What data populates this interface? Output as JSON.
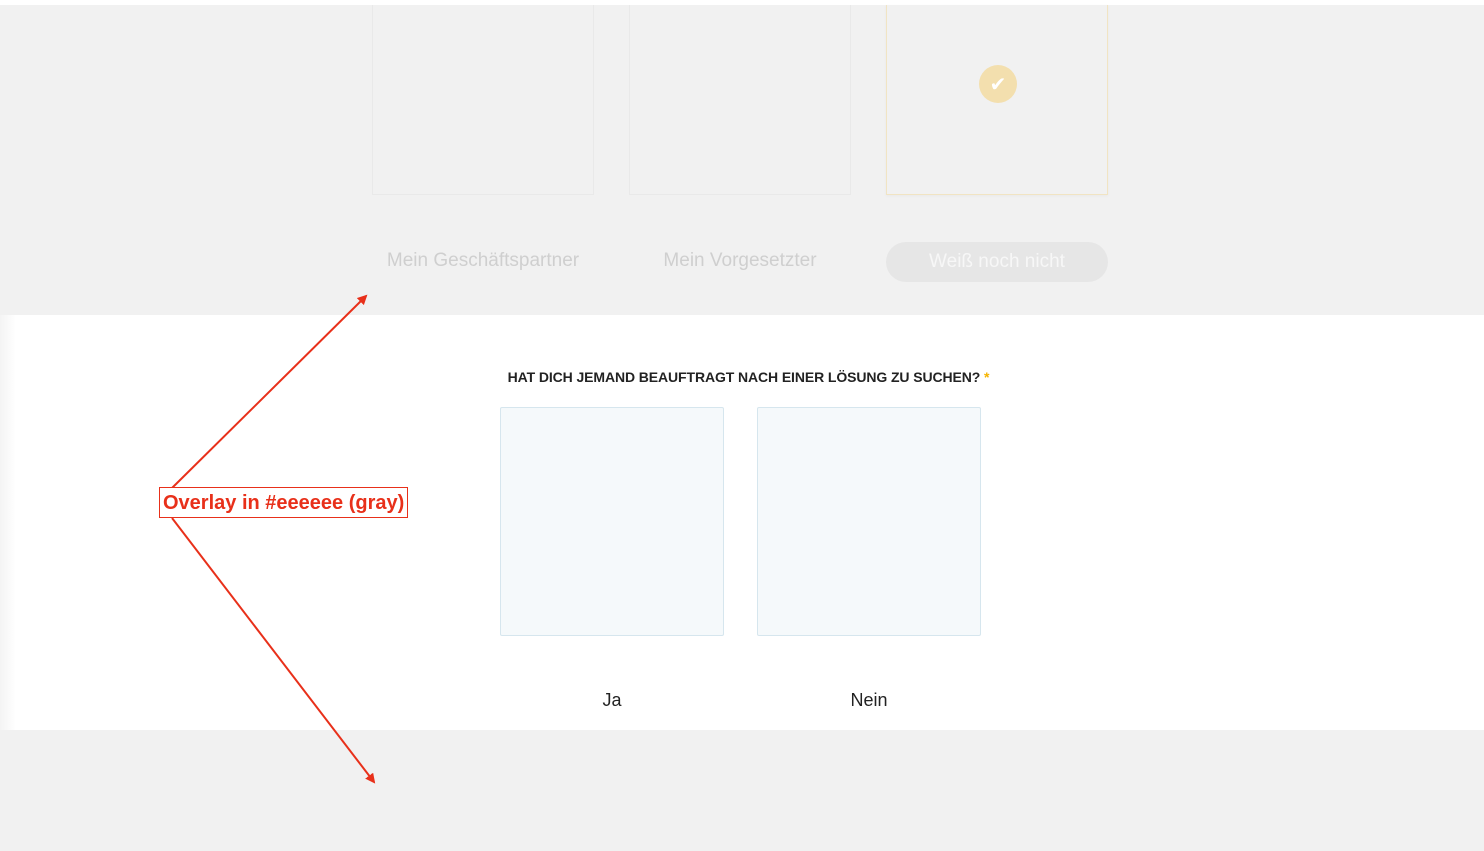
{
  "previous_question": {
    "options": [
      {
        "label": "Mein Geschäftspartner",
        "selected": false
      },
      {
        "label": "Mein Vorgesetzter",
        "selected": false
      },
      {
        "label": "Weiß noch nicht",
        "selected": true
      }
    ],
    "check_glyph": "✔",
    "check_icon": "check-icon"
  },
  "current_question": {
    "text": "HAT DICH JEMAND BEAUFTRAGT NACH EINER LÖSUNG ZU SUCHEN?",
    "required_marker": "*",
    "options": [
      {
        "label": "Ja"
      },
      {
        "label": "Nein"
      }
    ]
  },
  "annotation": {
    "text": "Overlay in #eeeeee (gray)",
    "color": "#e8301a"
  },
  "colors": {
    "overlay": "#f1f1f1",
    "required": "#f5b400",
    "card_fill": "#f5f9fb",
    "card_border": "#d6e6ee"
  }
}
